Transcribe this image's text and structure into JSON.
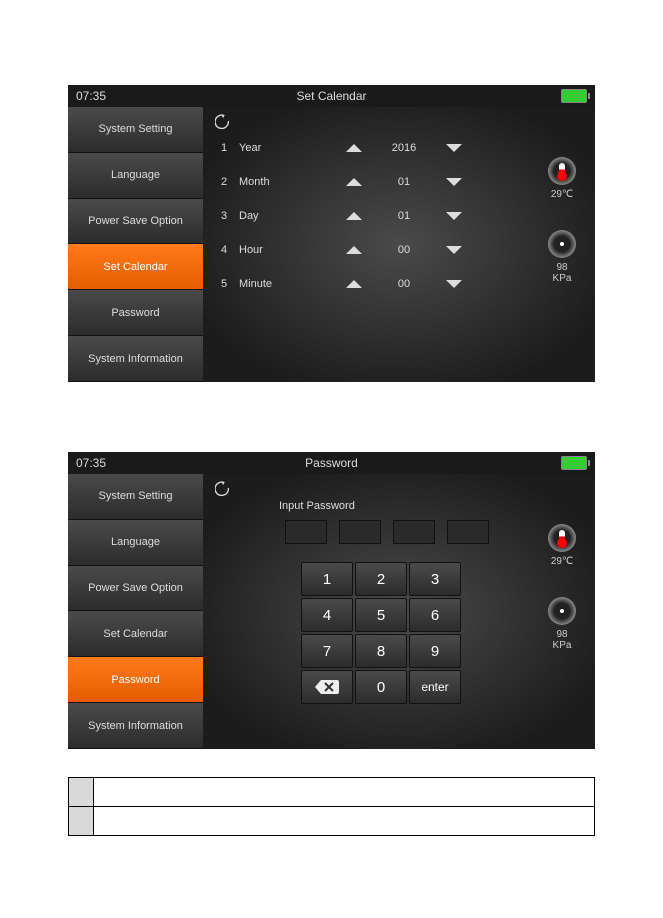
{
  "screen1": {
    "time": "07:35",
    "title": "Set Calendar",
    "sidebar": [
      "System Setting",
      "Language",
      "Power Save Option",
      "Set Calendar",
      "Password",
      "System Information"
    ],
    "active_index": 3,
    "rows": [
      {
        "idx": "1",
        "label": "Year",
        "value": "2016"
      },
      {
        "idx": "2",
        "label": "Month",
        "value": "01"
      },
      {
        "idx": "3",
        "label": "Day",
        "value": "01"
      },
      {
        "idx": "4",
        "label": "Hour",
        "value": "00"
      },
      {
        "idx": "5",
        "label": "Minute",
        "value": "00"
      }
    ],
    "temp": "29℃",
    "pressure_val": "98",
    "pressure_unit": "KPa"
  },
  "screen2": {
    "time": "07:35",
    "title": "Password",
    "sidebar": [
      "System Setting",
      "Language",
      "Power Save Option",
      "Set Calendar",
      "Password",
      "System Information"
    ],
    "active_index": 4,
    "input_label": "Input Password",
    "keys": [
      "1",
      "2",
      "3",
      "4",
      "5",
      "6",
      "7",
      "8",
      "9",
      "backspace",
      "0",
      "enter"
    ],
    "temp": "29℃",
    "pressure_val": "98",
    "pressure_unit": "KPa"
  }
}
